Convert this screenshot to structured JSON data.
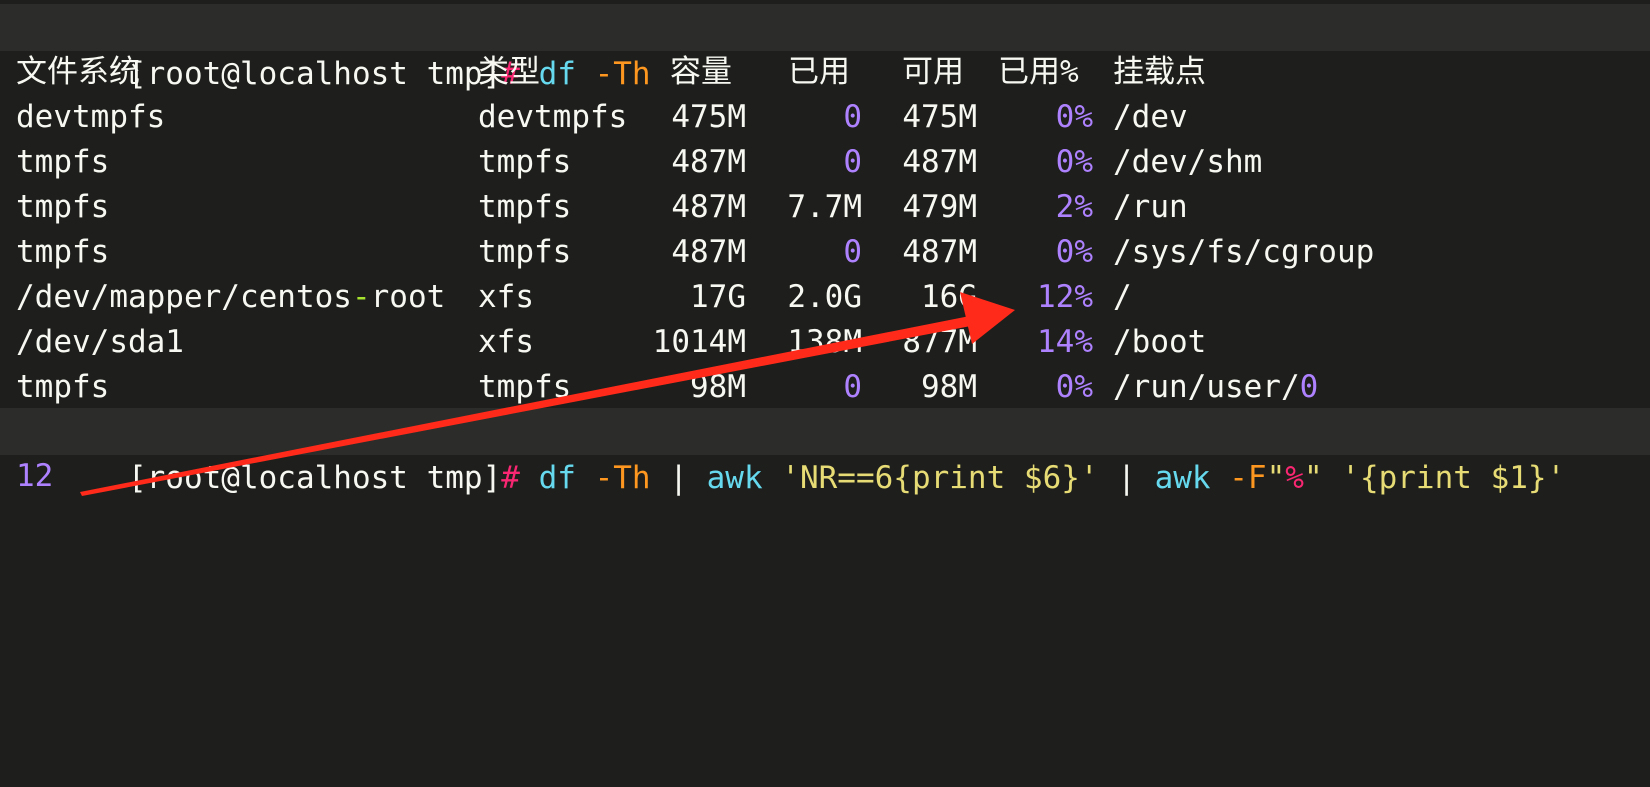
{
  "prompt": {
    "user_host_dir": "[root@localhost tmp]",
    "hash": "#"
  },
  "command1": {
    "cmd": "df",
    "flag": "-Th"
  },
  "header": {
    "filesystem": "文件系统",
    "type": "类型",
    "size": "容量",
    "used": "已用",
    "avail": "可用",
    "use_pct": "已用%",
    "mount": "挂载点"
  },
  "rows": [
    {
      "filesystem": "devtmpfs",
      "type": "devtmpfs",
      "size": "475M",
      "used": "0",
      "avail": "475M",
      "use_pct": "0%",
      "mount": "/dev"
    },
    {
      "filesystem": "tmpfs",
      "type": "tmpfs",
      "size": "487M",
      "used": "0",
      "avail": "487M",
      "use_pct": "0%",
      "mount": "/dev/shm"
    },
    {
      "filesystem": "tmpfs",
      "type": "tmpfs",
      "size": "487M",
      "used": "7.7M",
      "avail": "479M",
      "use_pct": "2%",
      "mount": "/run"
    },
    {
      "filesystem": "tmpfs",
      "type": "tmpfs",
      "size": "487M",
      "used": "0",
      "avail": "487M",
      "use_pct": "0%",
      "mount": "/sys/fs/cgroup"
    },
    {
      "filesystem": "/dev/mapper/centos-root",
      "type": "xfs",
      "size": "17G",
      "used": "2.0G",
      "avail": "16G",
      "use_pct": "12%",
      "mount": "/"
    },
    {
      "filesystem": "/dev/sda1",
      "type": "xfs",
      "size": "1014M",
      "used": "138M",
      "avail": "877M",
      "use_pct": "14%",
      "mount": "/boot"
    },
    {
      "filesystem": "tmpfs",
      "type": "tmpfs",
      "size": "98M",
      "used": "0",
      "avail": "98M",
      "use_pct": "0%",
      "mount": "/run/user/0"
    }
  ],
  "command2": {
    "df": "df",
    "df_flag": "-Th",
    "pipe1": "|",
    "awk1": "awk",
    "awk1_script": "'NR==6{print $6}'",
    "pipe2": "|",
    "awk2": "awk",
    "awk2_flag": "-F",
    "q1": "\"",
    "pct": "%",
    "q2": "\"",
    "awk2_script": "'{print $1}'"
  },
  "output": "12",
  "colors": {
    "background": "#1e1f1c",
    "highlight_line": "#2c2d2a",
    "numbers": "#ae81ff",
    "prompt_hash": "#f92672",
    "command": "#66d9ef",
    "flag": "#fd971f",
    "string": "#e6db74",
    "arrow": "#ff2a1a"
  }
}
